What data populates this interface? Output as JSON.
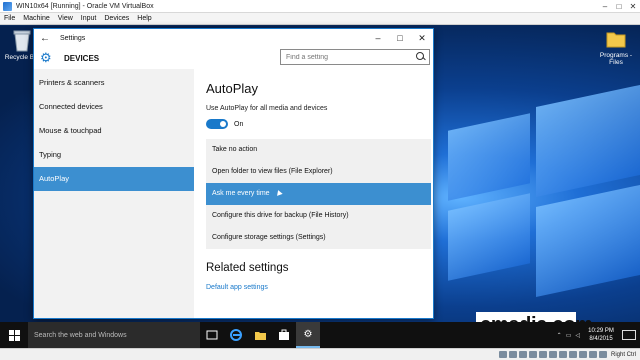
{
  "vbox": {
    "title": "WIN10x64 [Running] - Oracle VM VirtualBox",
    "menu": [
      "File",
      "Machine",
      "View",
      "Input",
      "Devices",
      "Help"
    ],
    "host_key": "Right Ctrl"
  },
  "desktop": {
    "icons": [
      {
        "label": "Recycle Bin",
        "icon": "recycle-bin-icon"
      },
      {
        "label": "Programs - Files",
        "icon": "folder-icon"
      }
    ],
    "watermark": "cmedia.com"
  },
  "settings": {
    "window_title": "Settings",
    "heading": "DEVICES",
    "search_placeholder": "Find a setting",
    "nav": [
      {
        "label": "Printers & scanners",
        "active": false
      },
      {
        "label": "Connected devices",
        "active": false
      },
      {
        "label": "Mouse & touchpad",
        "active": false
      },
      {
        "label": "Typing",
        "active": false
      },
      {
        "label": "AutoPlay",
        "active": true
      }
    ],
    "content": {
      "title": "AutoPlay",
      "lead": "Use AutoPlay for all media and devices",
      "toggle_state": "On",
      "options": [
        {
          "label": "Take no action",
          "selected": false
        },
        {
          "label": "Open folder to view files (File Explorer)",
          "selected": false
        },
        {
          "label": "Ask me every time",
          "selected": true
        },
        {
          "label": "Configure this drive for backup (File History)",
          "selected": false
        },
        {
          "label": "Configure storage settings (Settings)",
          "selected": false
        }
      ],
      "related_title": "Related settings",
      "related_link": "Default app settings"
    }
  },
  "taskbar": {
    "search_placeholder": "Search the web and Windows",
    "time": "10:29 PM",
    "date": "8/4/2015"
  },
  "colors": {
    "accent": "#1979ca",
    "selection": "#3c8fd0"
  }
}
